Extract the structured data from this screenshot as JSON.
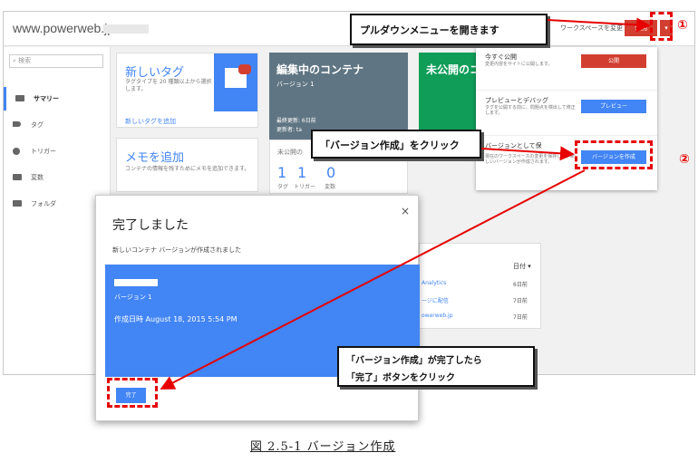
{
  "browser": {
    "site": "www.powerweb.jp"
  },
  "header": {
    "workspace_link": "ワークスペースを変更",
    "publish_label": "公開",
    "caret": "▾"
  },
  "sidebar": {
    "search_placeholder": "検索",
    "items": [
      {
        "label": "サマリー",
        "icon": "summary-icon"
      },
      {
        "label": "タグ",
        "icon": "tag-icon"
      },
      {
        "label": "トリガー",
        "icon": "trigger-icon"
      },
      {
        "label": "変数",
        "icon": "variable-icon"
      },
      {
        "label": "フォルダ",
        "icon": "folder-icon"
      }
    ]
  },
  "cards": {
    "new_tag": {
      "title": "新しいタグ",
      "desc": "タグタイプを 20 種類以上から選択します。",
      "link": "新しいタグを追加"
    },
    "memo": {
      "title": "メモを追加",
      "desc": "コンテナの情報を残すためにメモを追加できます。"
    },
    "editing": {
      "title": "編集中のコンテナ",
      "version": "バージョン 1",
      "updated_label": "最終更新: 6日前",
      "editor_label": "更新者: ta",
      "unpublished_label": "未公開の",
      "counts": [
        {
          "num": "1",
          "label": "タグ"
        },
        {
          "num": "1",
          "label": "トリガー"
        },
        {
          "num": "0",
          "label": "変数"
        }
      ]
    },
    "unpublished": {
      "title": "未公開のコ"
    }
  },
  "dropdown": {
    "publish_now": {
      "title": "今すぐ公開",
      "desc": "変更内容をサイトに公開します。",
      "button": "公開"
    },
    "preview": {
      "title": "プレビューとデバッグ",
      "desc": "タグを公開する前に、問題点を検出して修正します。",
      "button": "プレビュー"
    },
    "create_version": {
      "title": "バージョンとして保",
      "desc": "現在のワークスペースの変更を保存して、新しいバージョンが作成されます。",
      "button": "バージョンを作成"
    }
  },
  "dialog": {
    "title": "完了しました",
    "close": "×",
    "message": "新しいコンテナ バージョンが作成されました",
    "version_label": "バージョン 1",
    "created_at": "作成日時 August 18, 2015 5:54 PM",
    "done_button": "完了"
  },
  "right_panel": {
    "header": "日付 ▾",
    "rows": [
      {
        "name": "Analytics",
        "date": "6日前"
      },
      {
        "name": "ージに配信",
        "date": "7日前"
      },
      {
        "name": "owerweb.jp",
        "date": "7日前"
      }
    ]
  },
  "annotations": {
    "callout1": "プルダウンメニューを開きます",
    "callout2": "「バージョン作成」をクリック",
    "callout3_line1": "「バージョン作成」が完了したら",
    "callout3_line2": "「完了」ボタンをクリック",
    "marker1": "①",
    "marker2": "②",
    "caption": "図 2.5-1 バージョン作成"
  },
  "colors": {
    "accent_blue": "#4285f4",
    "publish_red": "#d23f31",
    "slate": "#5f7583",
    "green": "#0f9d58",
    "annotation_red": "#e60000"
  }
}
